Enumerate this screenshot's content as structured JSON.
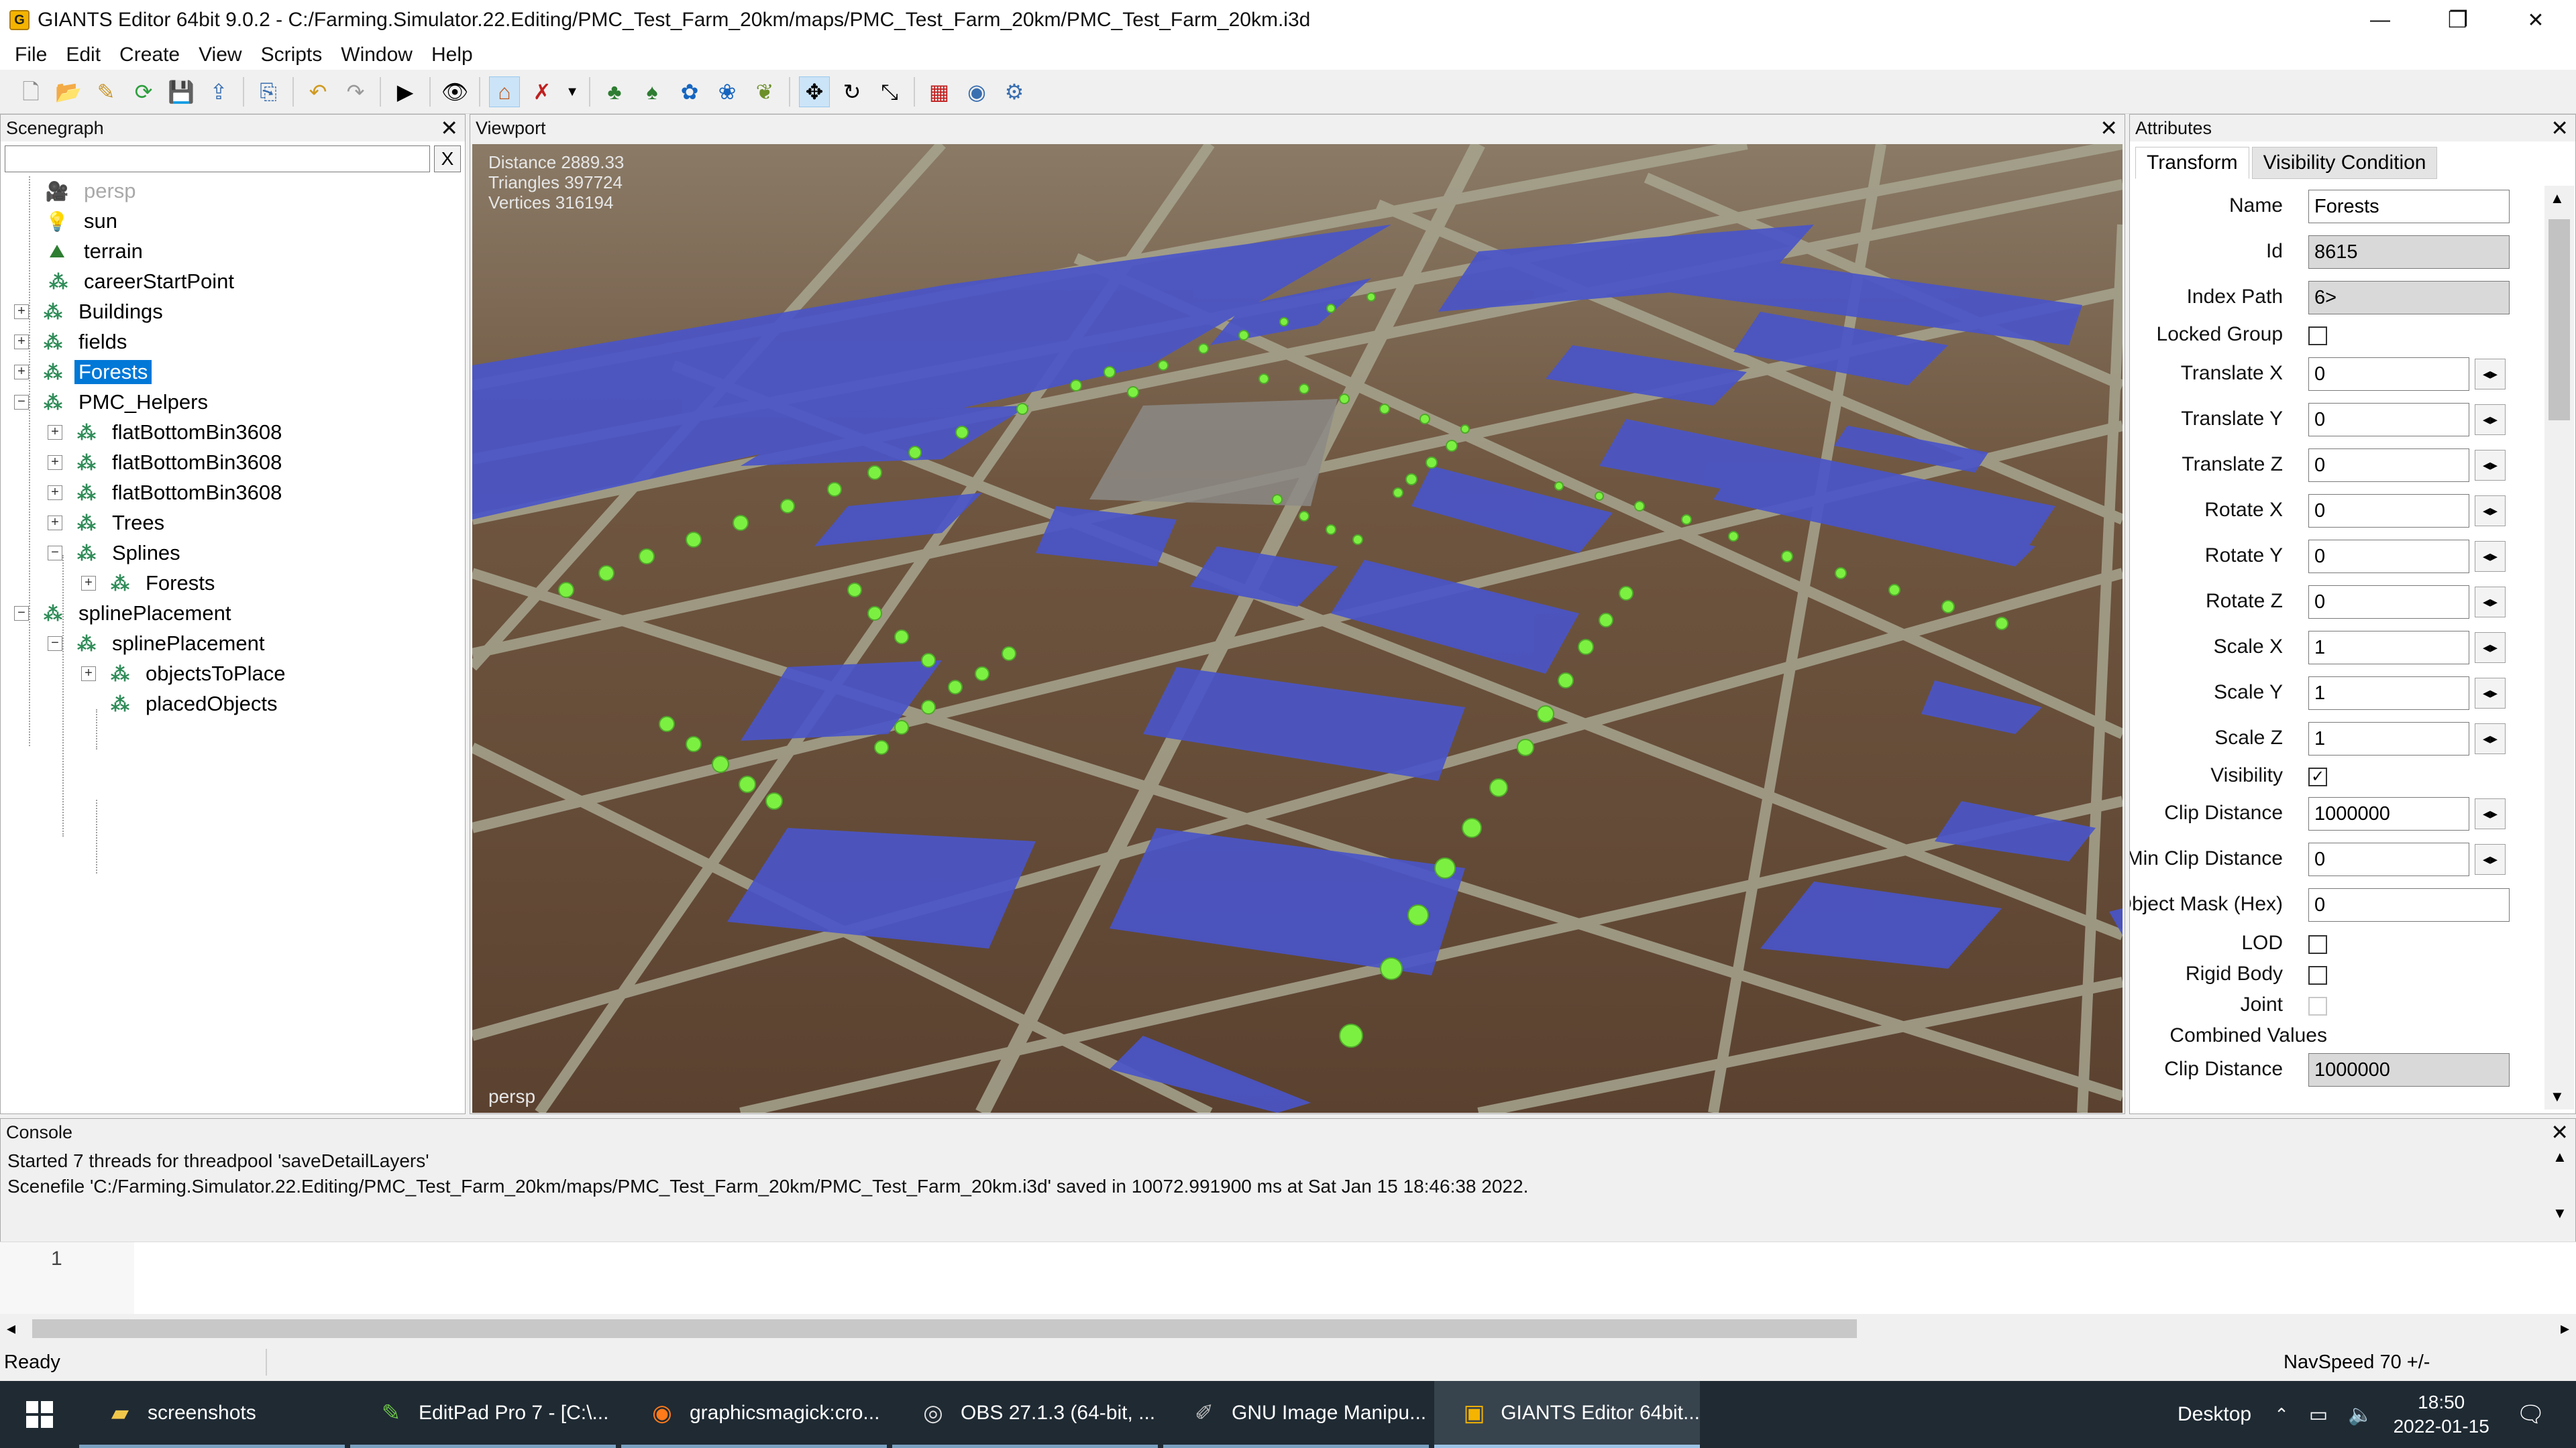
{
  "window": {
    "title": "GIANTS Editor 64bit 9.0.2 - C:/Farming.Simulator.22.Editing/PMC_Test_Farm_20km/maps/PMC_Test_Farm_20km/PMC_Test_Farm_20km.i3d",
    "minimize": "—",
    "restore": "❐",
    "close": "✕"
  },
  "menu": [
    "File",
    "Edit",
    "Create",
    "View",
    "Scripts",
    "Window",
    "Help"
  ],
  "scenegraph": {
    "title": "Scenegraph",
    "close": "✕",
    "filter_clear": "X",
    "nodes": [
      {
        "label": "persp",
        "icon": "camera-icon"
      },
      {
        "label": "sun",
        "icon": "light-icon"
      },
      {
        "label": "terrain",
        "icon": "terrain-icon"
      },
      {
        "label": "careerStartPoint",
        "icon": "transformgroup-icon"
      },
      {
        "label": "Buildings",
        "icon": "transformgroup-icon"
      },
      {
        "label": "fields",
        "icon": "transformgroup-icon"
      },
      {
        "label": "Forests",
        "icon": "transformgroup-icon"
      },
      {
        "label": "PMC_Helpers",
        "icon": "transformgroup-icon"
      },
      {
        "label": "flatBottomBin3608",
        "icon": "transformgroup-icon"
      },
      {
        "label": "flatBottomBin3608",
        "icon": "transformgroup-icon"
      },
      {
        "label": "flatBottomBin3608",
        "icon": "transformgroup-icon"
      },
      {
        "label": "Trees",
        "icon": "transformgroup-icon"
      },
      {
        "label": "Splines",
        "icon": "transformgroup-icon"
      },
      {
        "label": "Forests",
        "icon": "transformgroup-icon"
      },
      {
        "label": "splinePlacement",
        "icon": "transformgroup-icon"
      },
      {
        "label": "splinePlacement",
        "icon": "transformgroup-icon"
      },
      {
        "label": "objectsToPlace",
        "icon": "transformgroup-icon"
      },
      {
        "label": "placedObjects",
        "icon": "transformgroup-icon"
      }
    ],
    "selected": "Forests"
  },
  "viewport": {
    "title": "Viewport",
    "close": "✕",
    "stats": [
      "Distance 2889.33",
      "Triangles 397724",
      "Vertices 316194"
    ],
    "camera": "persp"
  },
  "attributes": {
    "title": "Attributes",
    "close": "✕",
    "tabs": [
      "Transform",
      "Visibility Condition"
    ],
    "rows": [
      {
        "label": "Name",
        "value": "Forests"
      },
      {
        "label": "Id",
        "value": "8615"
      },
      {
        "label": "Index Path",
        "value": "6>"
      },
      {
        "label": "Locked Group",
        "value": ""
      },
      {
        "label": "Translate X",
        "value": "0"
      },
      {
        "label": "Translate Y",
        "value": "0"
      },
      {
        "label": "Translate Z",
        "value": "0"
      },
      {
        "label": "Rotate X",
        "value": "0"
      },
      {
        "label": "Rotate Y",
        "value": "0"
      },
      {
        "label": "Rotate Z",
        "value": "0"
      },
      {
        "label": "Scale X",
        "value": "1"
      },
      {
        "label": "Scale Y",
        "value": "1"
      },
      {
        "label": "Scale Z",
        "value": "1"
      },
      {
        "label": "Visibility",
        "value": "✓"
      },
      {
        "label": "Clip Distance",
        "value": "1000000"
      },
      {
        "label": "Min Clip Distance",
        "value": "0"
      },
      {
        "label": "Object Mask (Hex)",
        "value": "0"
      },
      {
        "label": "LOD",
        "value": ""
      },
      {
        "label": "Rigid Body",
        "value": ""
      },
      {
        "label": "Joint",
        "value": ""
      },
      {
        "label": "Combined Values",
        "value": ""
      },
      {
        "label": "Clip Distance",
        "value": "1000000"
      }
    ],
    "spin_glyph": "◂▸"
  },
  "console": {
    "title": "Console",
    "close": "✕",
    "lines": [
      "Started 7 threads for threadpool 'saveDetailLayers'",
      "Scenefile 'C:/Farming.Simulator.22.Editing/PMC_Test_Farm_20km/maps/PMC_Test_Farm_20km/PMC_Test_Farm_20km.i3d' saved in 10072.991900 ms at Sat Jan 15 18:46:38 2022."
    ],
    "line_number": "1"
  },
  "status": {
    "left": "Ready",
    "right": "NavSpeed 70 +/-"
  },
  "taskbar": {
    "apps": [
      {
        "label": "screenshots",
        "icon": "folder-icon"
      },
      {
        "label": "EditPad Pro 7 - [C:\\...",
        "icon": "editpad-icon"
      },
      {
        "label": "graphicsmagick:cro...",
        "icon": "firefox-icon"
      },
      {
        "label": "OBS 27.1.3 (64-bit, ...",
        "icon": "obs-icon"
      },
      {
        "label": "GNU Image Manipu...",
        "icon": "gimp-icon"
      },
      {
        "label": "GIANTS Editor 64bit...",
        "icon": "giants-icon"
      }
    ],
    "desktop": "Desktop",
    "time": "18:50",
    "date": "2022-01-15"
  },
  "colors": {
    "accent": "#0078d7",
    "field": "#4a55c8",
    "tree": "#7cf041",
    "soil": "#6b5138",
    "road": "#a7a58f"
  }
}
